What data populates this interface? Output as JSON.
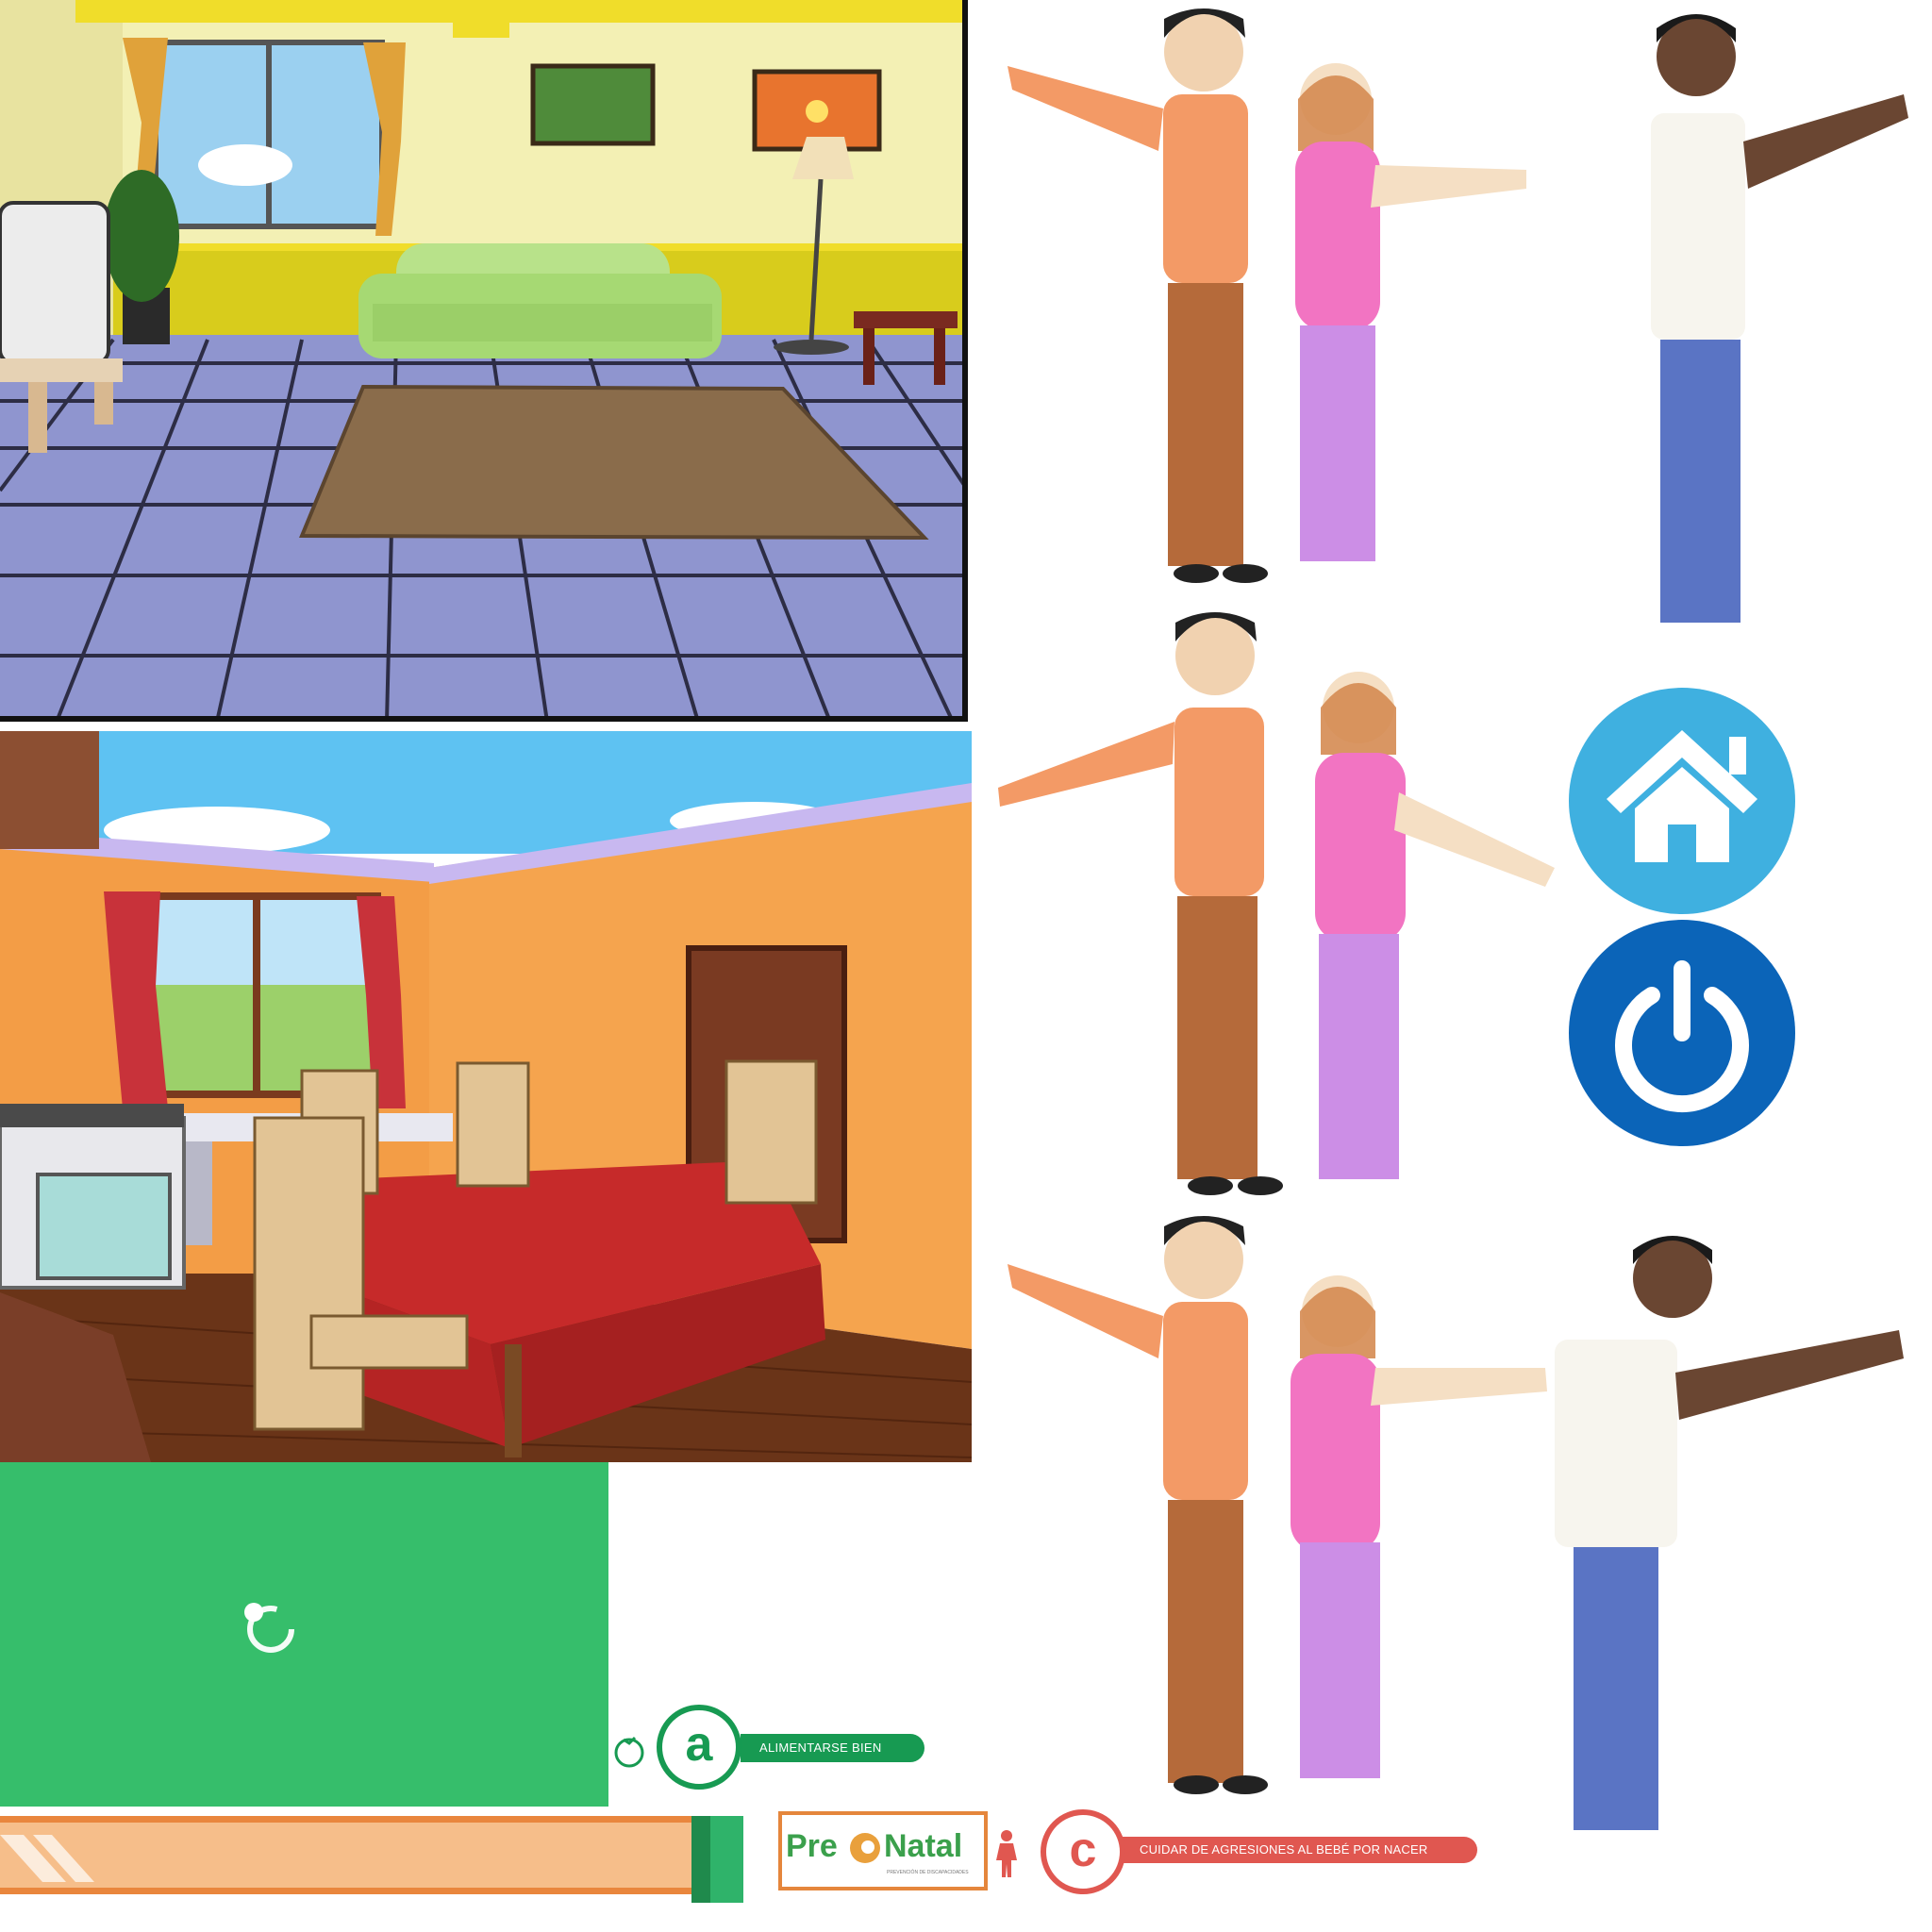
{
  "scenes": {
    "living_room": "living-room-scene",
    "kitchen": "kitchen-scene"
  },
  "buttons": {
    "home_icon": "home-icon",
    "power_icon": "power-icon"
  },
  "badges": {
    "a_letter": "a",
    "a_label": "ALIMENTARSE BIEN",
    "c_letter": "c",
    "c_label": "CUIDAR DE AGRESIONES AL BEBÉ POR NACER"
  },
  "logo": {
    "pre": "Pre",
    "natal": "Natal",
    "subtitle": "PREVENCIÓN DE DISCAPACIDADES"
  },
  "colors": {
    "panel_green": "#36be6b",
    "badge_green": "#179a52",
    "badge_red": "#e05750",
    "home_blue": "#3fb0e0",
    "power_blue": "#0b64b8",
    "bar_orange": "#f6be8a"
  }
}
